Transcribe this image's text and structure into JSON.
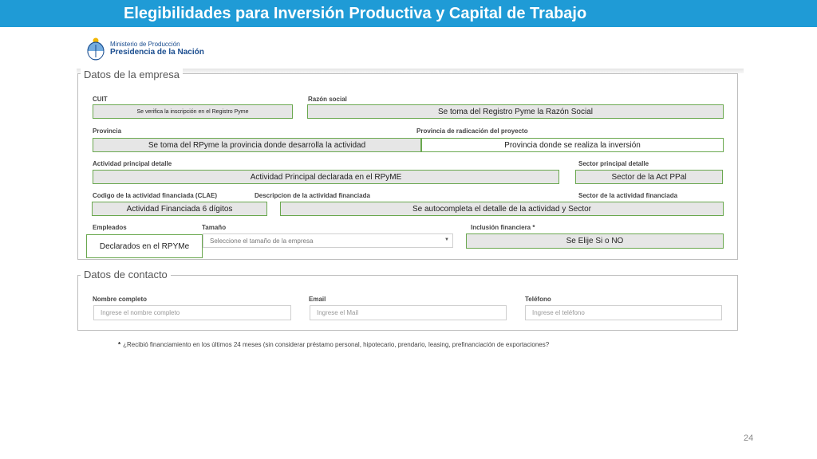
{
  "slide": {
    "title": "Elegibilidades para Inversión Productiva y Capital de Trabajo",
    "page_number": "24"
  },
  "logo": {
    "line1": "Ministerio de Producción",
    "line2": "Presidencia de la Nación"
  },
  "colors": {
    "title_bar": "#1f9bd6",
    "note_border": "#6aa84f",
    "note_fill": "#e6e6e6"
  },
  "company": {
    "legend": "Datos de la empresa",
    "labels": {
      "cuit": "CUIT",
      "razon_social": "Razón social",
      "provincia": "Provincia",
      "provincia_radicacion": "Provincia de radicación del proyecto",
      "actividad_principal": "Actividad principal detalle",
      "sector_principal": "Sector principal detalle",
      "codigo_clae": "Codigo de la actividad financiada (CLAE)",
      "descripcion_actividad": "Descripcion de la actividad financiada",
      "sector_actividad": "Sector de la actividad financiada",
      "empleados": "Empleados",
      "tamano": "Tamaño",
      "inclusion": "Inclusión financiera *"
    },
    "notes": {
      "cuit": "Se verifica la inscripción en el Registro Pyme",
      "razon_social": "Se toma del Registro Pyme la Razón Social",
      "provincia": "Se toma del RPyme la provincia donde desarrolla la actividad",
      "provincia_radicacion": "Provincia donde se realiza la inversión",
      "actividad_principal": "Actividad Principal declarada en el RPyME",
      "sector_principal": "Sector de la Act PPal",
      "codigo_clae": "Actividad Financiada 6 dígitos",
      "descripcion": "Se autocompleta  el detalle de la actividad y Sector",
      "empleados": "Declarados en el RPYMe",
      "inclusion": "Se Elije Si o NO"
    },
    "tamano_select": "Seleccione el tamaño de la empresa"
  },
  "contact": {
    "legend": "Datos de contacto",
    "labels": {
      "nombre": "Nombre completo",
      "email": "Email",
      "telefono": "Teléfono"
    },
    "placeholders": {
      "nombre": "Ingrese el nombre completo",
      "email": "Ingrese el Mail",
      "telefono": "Ingrese el teléfono"
    }
  },
  "question": {
    "marker": "*",
    "text": "¿Recibió financiamiento en los últimos 24 meses (sin considerar préstamo personal, hipotecario, prendario, leasing, prefinanciación de exportaciones?"
  }
}
